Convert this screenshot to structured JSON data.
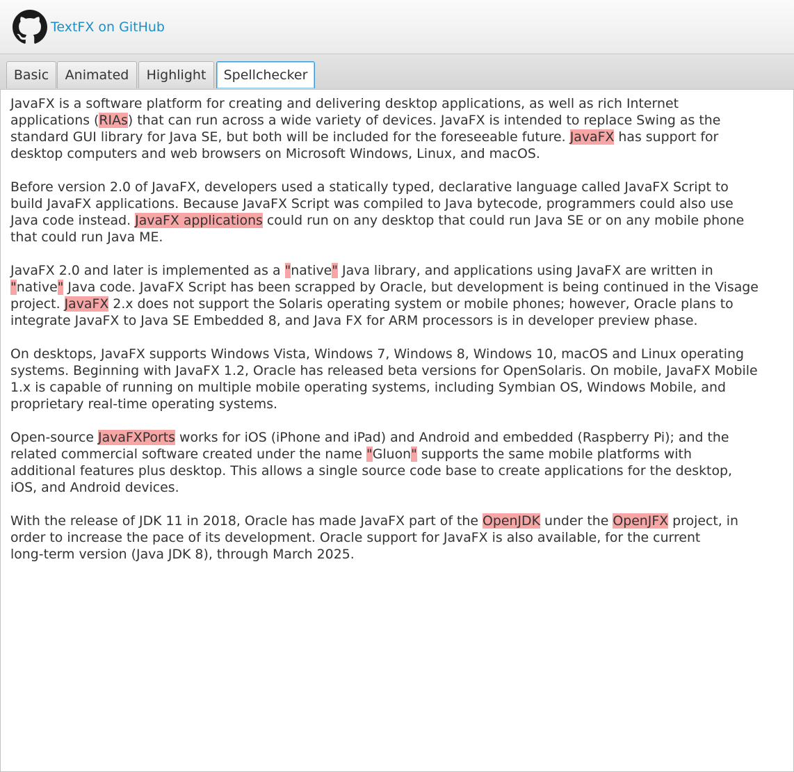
{
  "header": {
    "link_label": "TextFX on GitHub",
    "logo_icon": "github-icon",
    "link_color": "#1a8fc8"
  },
  "tabs": [
    {
      "label": "Basic",
      "selected": false
    },
    {
      "label": "Animated",
      "selected": false
    },
    {
      "label": "Highlight",
      "selected": false
    },
    {
      "label": "Spellchecker",
      "selected": true
    }
  ],
  "highlight_color": "#f8a5a5",
  "paragraphs": [
    [
      {
        "t": "JavaFX is a software platform for creating and delivering desktop applications, as well as rich Internet\napplications ("
      },
      {
        "t": "RIAs",
        "e": true
      },
      {
        "t": ") that can run across a wide variety of devices. JavaFX is intended to replace Swing as the\nstandard GUI library for Java SE, but both will be included for the foreseeable future. "
      },
      {
        "t": "JavaFX",
        "e": true
      },
      {
        "t": " has support for\ndesktop computers and web browsers on Microsoft Windows, Linux, and macOS."
      }
    ],
    [
      {
        "t": "Before version 2.0 of JavaFX, developers used a statically typed, declarative language called JavaFX Script to\nbuild JavaFX applications. Because JavaFX Script was compiled to Java bytecode, programmers could also use\nJava code instead. "
      },
      {
        "t": "JavaFX applications",
        "e": true
      },
      {
        "t": " could run on any desktop that could run Java SE or on any mobile phone\nthat could run Java ME."
      }
    ],
    [
      {
        "t": "JavaFX 2.0 and later is implemented as a "
      },
      {
        "t": "\"",
        "e": true
      },
      {
        "t": "native"
      },
      {
        "t": "\"",
        "e": true
      },
      {
        "t": " Java library, and applications using JavaFX are written in\n"
      },
      {
        "t": "\"",
        "e": true
      },
      {
        "t": "native"
      },
      {
        "t": "\"",
        "e": true
      },
      {
        "t": " Java code. JavaFX Script has been scrapped by Oracle, but development is being continued in the Visage\nproject. "
      },
      {
        "t": "JavaFX",
        "e": true
      },
      {
        "t": " 2.x does not support the Solaris operating system or mobile phones; however, Oracle plans to\nintegrate JavaFX to Java SE Embedded 8, and Java FX for ARM processors is in developer preview phase."
      }
    ],
    [
      {
        "t": "On desktops, JavaFX supports Windows Vista, Windows 7, Windows 8, Windows 10, macOS and Linux operating\nsystems. Beginning with JavaFX 1.2, Oracle has released beta versions for OpenSolaris. On mobile, JavaFX Mobile\n1.x is capable of running on multiple mobile operating systems, including Symbian OS, Windows Mobile, and\nproprietary real-time operating systems."
      }
    ],
    [
      {
        "t": "Open-source "
      },
      {
        "t": "JavaFXPorts",
        "e": true
      },
      {
        "t": " works for iOS (iPhone and iPad) and Android and embedded (Raspberry Pi); and the\nrelated commercial software created under the name "
      },
      {
        "t": "\"",
        "e": true
      },
      {
        "t": "Gluon"
      },
      {
        "t": "\"",
        "e": true
      },
      {
        "t": " supports the same mobile platforms with\nadditional features plus desktop. This allows a single source code base to create applications for the desktop,\niOS, and Android devices."
      }
    ],
    [
      {
        "t": "With the release of JDK 11 in 2018, Oracle has made JavaFX part of the "
      },
      {
        "t": "OpenJDK",
        "e": true
      },
      {
        "t": " under the "
      },
      {
        "t": "OpenJFX",
        "e": true
      },
      {
        "t": " project, in\norder to increase the pace of its development. Oracle support for JavaFX is also available, for the current\nlong-term version (Java JDK 8), through March 2025."
      }
    ]
  ]
}
